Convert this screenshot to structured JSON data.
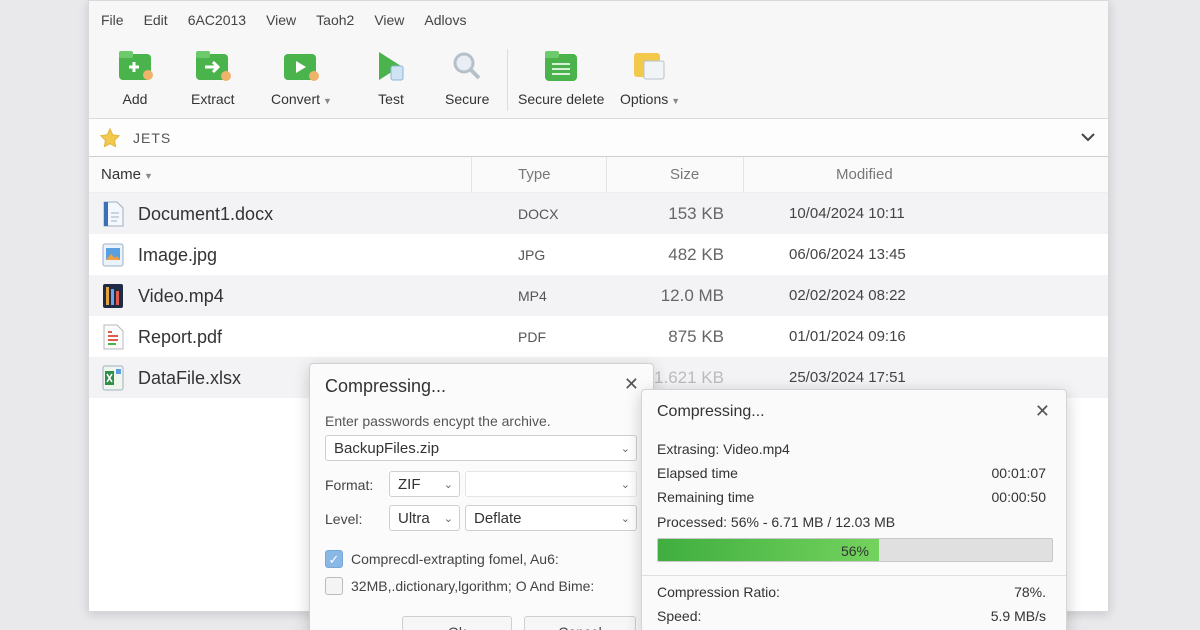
{
  "menu": [
    "File",
    "Edit",
    "6AC2013",
    "View",
    "Taoh2",
    "View",
    "Adlovs"
  ],
  "toolbar": {
    "add": "Add",
    "extract": "Extract",
    "convert": "Convert",
    "test": "Test",
    "secure": "Secure",
    "secure_delete": "Secure delete",
    "options": "Options"
  },
  "pathbar": {
    "path": "JETS"
  },
  "columns": {
    "name": "Name",
    "type": "Type",
    "size": "Size",
    "modified": "Modified"
  },
  "files": [
    {
      "name": "Document1.docx",
      "type": "DOCX",
      "size": "153 KB",
      "modified": "10/04/2024 10:11"
    },
    {
      "name": "Image.jpg",
      "type": "JPG",
      "size": "482 KB",
      "modified": "06/06/2024 13:45"
    },
    {
      "name": "Video.mp4",
      "type": "MP4",
      "size": "12.0 MB",
      "modified": "02/02/2024 08:22"
    },
    {
      "name": "Report.pdf",
      "type": "PDF",
      "size": "875 KB",
      "modified": "01/01/2024 09:16"
    },
    {
      "name": "DataFile.xlsx",
      "type": "",
      "size": "1.621 KB",
      "modified": "25/03/2024 17:51"
    }
  ],
  "compress_dialog": {
    "title": "Compressing...",
    "prompt": "Enter passwords encypt the archive.",
    "archive_name": "BackupFiles.zip",
    "format_label": "Format:",
    "format_value": "ZIF",
    "level_label": "Level:",
    "level_value": "Ultra",
    "method_value": "Deflate",
    "option1": "Comprecdl-extrapting fomel, Au6:",
    "option1_checked": true,
    "option2": "32MB,.dictionary,lgorithm; O  And Bime:",
    "option2_checked": false,
    "ok_label": "Ok",
    "cancel_label": "Cancel"
  },
  "progress_dialog": {
    "title": "Compressing...",
    "current": "Extrasing: Video.mp4",
    "elapsed_label": "Elapsed time",
    "elapsed_value": "00:01:07",
    "remaining_label": "Remaining time",
    "remaining_value": "00:00:50",
    "processed": "Processed: 56% - 6.71 MB / 12.03 MB",
    "progress_percent": 56,
    "progress_text": "56%",
    "ratio_label": "Compression Ratio:",
    "ratio_value": "78%.",
    "speed_label": "Speed:",
    "speed_value": "5.9 MB/s"
  },
  "colors": {
    "accent_green": "#3fae3f",
    "star": "#f2c94c",
    "check": "#8ab8e6"
  }
}
